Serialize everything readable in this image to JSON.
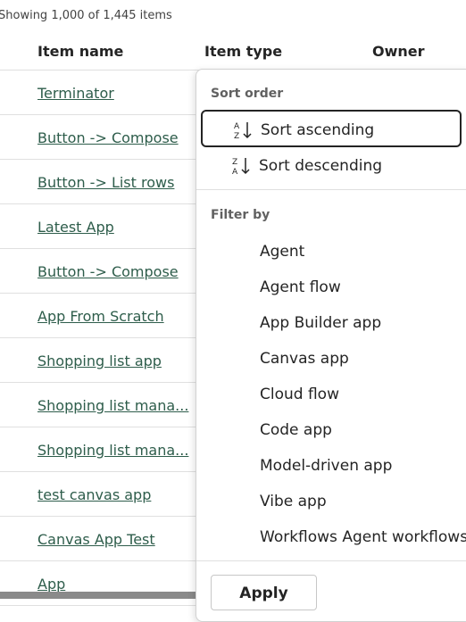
{
  "summary": "Showing 1,000 of 1,445 items",
  "columns": {
    "name": "Item name",
    "type": "Item type",
    "owner": "Owner"
  },
  "rows": [
    "Terminator",
    "Button -> Compose",
    "Button -> List rows",
    "Latest App",
    "Button -> Compose",
    "App From Scratch",
    "Shopping list app",
    "Shopping list mana...",
    "Shopping list mana...",
    "test canvas app",
    "Canvas App Test",
    "App"
  ],
  "menu": {
    "sort_title": "Sort order",
    "sort_ascending": "Sort ascending",
    "sort_descending": "Sort descending",
    "filter_title": "Filter by",
    "filters": [
      "Agent",
      "Agent flow",
      "App Builder app",
      "Canvas app",
      "Cloud flow",
      "Code app",
      "Model-driven app",
      "Vibe app",
      "Workflows Agent workflows"
    ],
    "apply": "Apply"
  },
  "icons": {
    "sort_ascending": "sort-ascending-icon",
    "sort_descending": "sort-descending-icon"
  },
  "colors": {
    "link": "#2e5d4b",
    "focus_border": "#242424"
  }
}
